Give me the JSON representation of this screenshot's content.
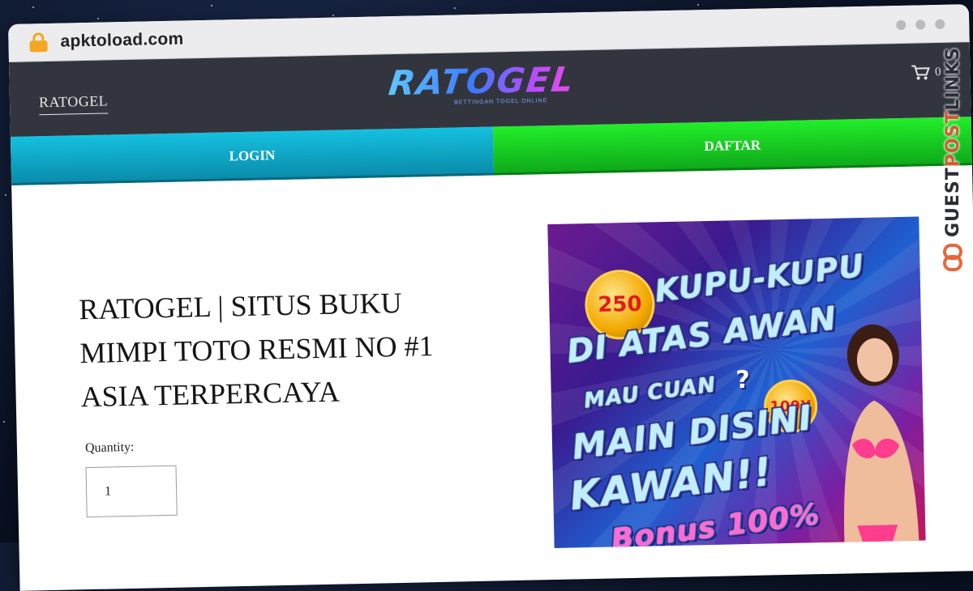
{
  "browser": {
    "url": "apktoload.com",
    "icon": "lock-icon"
  },
  "header": {
    "brand_link": "RATOGEL",
    "logo_text": "RATOGEL",
    "logo_tagline": "BETTINGAN TOGEL ONLINE",
    "cart_count": "0",
    "cart_icon": "cart-icon"
  },
  "nav": {
    "login_label": "LOGIN",
    "daftar_label": "DAFTAR",
    "colors": {
      "login": "#0ea6c4",
      "daftar": "#1ad425"
    }
  },
  "product": {
    "title": "RATOGEL | SITUS BUKU MIMPI TOTO RESMI NO #1 ASIA TERPERCAYA",
    "quantity_label": "Quantity:",
    "quantity_value": "1"
  },
  "banner": {
    "line1": "KUPU-KUPU",
    "line2": "DI ATAS AWAN",
    "line3": "MAU CUAN",
    "question": "?",
    "line4": "MAIN DISINI",
    "line5": "KAWAN!!",
    "line6": "Bonus 100%",
    "coin_big": "250",
    "coin_small": "100X"
  },
  "watermark": {
    "text_prefix": "GUEST",
    "text_accent": "POST",
    "text_suffix": "LINKS",
    "icon": "chain-link-icon"
  }
}
